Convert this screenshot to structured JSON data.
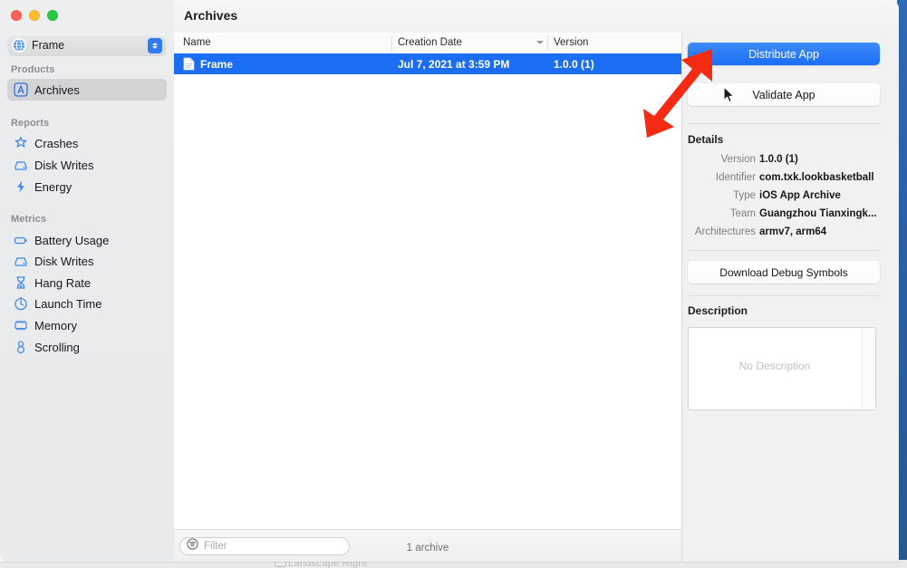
{
  "window": {
    "traffic_lights": [
      "close",
      "minimize",
      "zoom"
    ],
    "title": "Archives"
  },
  "sidebar": {
    "scheme": {
      "label": "Frame",
      "icon": "globe-icon",
      "chevron": "updown-chevron-icon"
    },
    "sections": [
      {
        "header": "Products",
        "items": [
          {
            "label": "Archives",
            "icon": "archive-app-icon",
            "selected": true
          }
        ]
      },
      {
        "header": "Reports",
        "items": [
          {
            "label": "Crashes",
            "icon": "crashes-icon",
            "selected": false
          },
          {
            "label": "Disk Writes",
            "icon": "disk-writes-icon",
            "selected": false
          },
          {
            "label": "Energy",
            "icon": "energy-icon",
            "selected": false
          }
        ]
      },
      {
        "header": "Metrics",
        "items": [
          {
            "label": "Battery Usage",
            "icon": "battery-icon",
            "selected": false
          },
          {
            "label": "Disk Writes",
            "icon": "disk-writes-icon",
            "selected": false
          },
          {
            "label": "Hang Rate",
            "icon": "hourglass-icon",
            "selected": false
          },
          {
            "label": "Launch Time",
            "icon": "stopwatch-icon",
            "selected": false
          },
          {
            "label": "Memory",
            "icon": "memory-icon",
            "selected": false
          },
          {
            "label": "Scrolling",
            "icon": "scrolling-icon",
            "selected": false
          }
        ]
      }
    ]
  },
  "table": {
    "columns": [
      "Name",
      "Creation Date",
      "Version"
    ],
    "sorted_column": "Creation Date",
    "rows": [
      {
        "name": "Frame",
        "creation_date": "Jul 7, 2021 at 3:59 PM",
        "version": "1.0.0 (1)",
        "selected": true
      }
    ]
  },
  "status_bar": {
    "filter_placeholder": "Filter",
    "filter_value": "",
    "filter_icon": "filter-icon",
    "count": "1 archive"
  },
  "details": {
    "distribute_label": "Distribute App",
    "validate_label": "Validate App",
    "download_dsym_label": "Download Debug Symbols",
    "section_title": "Details",
    "fields": [
      {
        "key": "Version",
        "value": "1.0.0 (1)"
      },
      {
        "key": "Identifier",
        "value": "com.txk.lookbasketball"
      },
      {
        "key": "Type",
        "value": "iOS App Archive"
      },
      {
        "key": "Team",
        "value": "Guangzhou Tianxingk..."
      },
      {
        "key": "Architectures",
        "value": "armv7, arm64"
      }
    ],
    "description_title": "Description",
    "description_placeholder": "No Description"
  },
  "annotation": {
    "arrow_color": "#f42a13",
    "points_to": "Distribute App"
  },
  "colors": {
    "accent_blue": "#1b6ef3",
    "selection_blue": "#1b6ef3",
    "sidebar_bg": "#e9ebed",
    "panel_bg": "#f2f1f2"
  },
  "behind": {
    "text": "Landscape Right"
  }
}
